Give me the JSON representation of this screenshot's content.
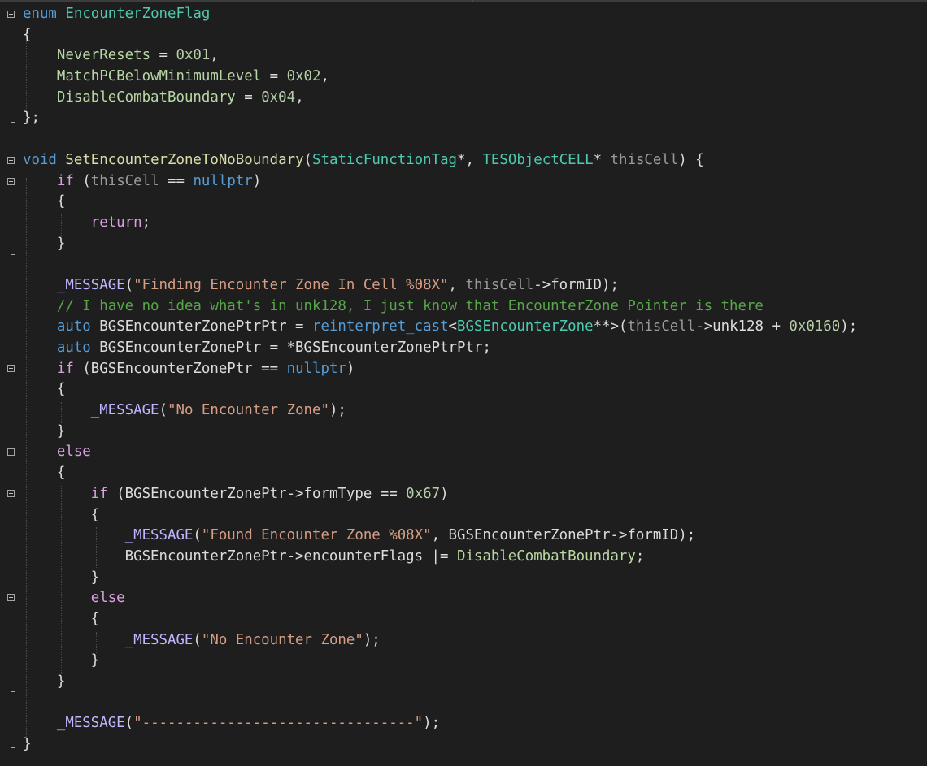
{
  "code_lines": [
    [
      [
        "kw",
        "enum"
      ],
      [
        "",
        "&nbsp;"
      ],
      [
        "ty",
        "EncounterZoneFlag"
      ]
    ],
    [
      [
        "",
        "{"
      ]
    ],
    [
      [
        "",
        "    "
      ],
      [
        "en",
        "NeverResets"
      ],
      [
        "",
        " = "
      ],
      [
        "num",
        "0x01"
      ],
      [
        "",
        ","
      ]
    ],
    [
      [
        "",
        "    "
      ],
      [
        "en",
        "MatchPCBelowMinimumLevel"
      ],
      [
        "",
        " = "
      ],
      [
        "num",
        "0x02"
      ],
      [
        "",
        ","
      ]
    ],
    [
      [
        "",
        "    "
      ],
      [
        "en",
        "DisableCombatBoundary"
      ],
      [
        "",
        " = "
      ],
      [
        "num",
        "0x04"
      ],
      [
        "",
        ","
      ]
    ],
    [
      [
        "",
        "};"
      ]
    ],
    [
      [
        "",
        ""
      ]
    ],
    [
      [
        "kw",
        "void"
      ],
      [
        "",
        " "
      ],
      [
        "fn",
        "SetEncounterZoneToNoBoundary"
      ],
      [
        "",
        "("
      ],
      [
        "ty",
        "StaticFunctionTag"
      ],
      [
        "",
        "*, "
      ],
      [
        "ty",
        "TESObjectCELL"
      ],
      [
        "",
        "* "
      ],
      [
        "pm",
        "thisCell"
      ],
      [
        "",
        ") {"
      ]
    ],
    [
      [
        "",
        "    "
      ],
      [
        "ctl",
        "if"
      ],
      [
        "",
        " ("
      ],
      [
        "pm",
        "thisCell"
      ],
      [
        "",
        " == "
      ],
      [
        "kw",
        "nullptr"
      ],
      [
        "",
        ")"
      ]
    ],
    [
      [
        "",
        "    {"
      ]
    ],
    [
      [
        "",
        "        "
      ],
      [
        "ctl",
        "return"
      ],
      [
        "",
        ";"
      ]
    ],
    [
      [
        "",
        "    }"
      ]
    ],
    [
      [
        "",
        ""
      ]
    ],
    [
      [
        "",
        "    "
      ],
      [
        "mac",
        "_MESSAGE"
      ],
      [
        "",
        "("
      ],
      [
        "str",
        "\"Finding Encounter Zone In Cell %08X\""
      ],
      [
        "",
        ", "
      ],
      [
        "pm",
        "thisCell"
      ],
      [
        "",
        "->formID);"
      ]
    ],
    [
      [
        "",
        "    "
      ],
      [
        "cm",
        "// I have no idea what's in unk128, I just know that EncounterZone Pointer is there"
      ]
    ],
    [
      [
        "",
        "    "
      ],
      [
        "kw",
        "auto"
      ],
      [
        "",
        " BGSEncounterZonePtrPtr = "
      ],
      [
        "kw",
        "reinterpret_cast"
      ],
      [
        "",
        "<"
      ],
      [
        "ty",
        "BGSEncounterZone"
      ],
      [
        "",
        "**>("
      ],
      [
        "pm",
        "thisCell"
      ],
      [
        "",
        "->unk128 + "
      ],
      [
        "num",
        "0x0160"
      ],
      [
        "",
        ");"
      ]
    ],
    [
      [
        "",
        "    "
      ],
      [
        "kw",
        "auto"
      ],
      [
        "",
        " BGSEncounterZonePtr = *BGSEncounterZonePtrPtr;"
      ]
    ],
    [
      [
        "",
        "    "
      ],
      [
        "ctl",
        "if"
      ],
      [
        "",
        " (BGSEncounterZonePtr == "
      ],
      [
        "kw",
        "nullptr"
      ],
      [
        "",
        ")"
      ]
    ],
    [
      [
        "",
        "    {"
      ]
    ],
    [
      [
        "",
        "        "
      ],
      [
        "mac",
        "_MESSAGE"
      ],
      [
        "",
        "("
      ],
      [
        "str",
        "\"No Encounter Zone\""
      ],
      [
        "",
        ");"
      ]
    ],
    [
      [
        "",
        "    }"
      ]
    ],
    [
      [
        "",
        "    "
      ],
      [
        "ctl",
        "else"
      ]
    ],
    [
      [
        "",
        "    {"
      ]
    ],
    [
      [
        "",
        "        "
      ],
      [
        "ctl",
        "if"
      ],
      [
        "",
        " (BGSEncounterZonePtr->formType == "
      ],
      [
        "num",
        "0x67"
      ],
      [
        "",
        ")"
      ]
    ],
    [
      [
        "",
        "        {"
      ]
    ],
    [
      [
        "",
        "            "
      ],
      [
        "mac",
        "_MESSAGE"
      ],
      [
        "",
        "("
      ],
      [
        "str",
        "\"Found Encounter Zone %08X\""
      ],
      [
        "",
        ", BGSEncounterZonePtr->formID);"
      ]
    ],
    [
      [
        "",
        "            BGSEncounterZonePtr->encounterFlags |= "
      ],
      [
        "en",
        "DisableCombatBoundary"
      ],
      [
        "",
        ";"
      ]
    ],
    [
      [
        "",
        "        }"
      ]
    ],
    [
      [
        "",
        "        "
      ],
      [
        "ctl",
        "else"
      ]
    ],
    [
      [
        "",
        "        {"
      ]
    ],
    [
      [
        "",
        "            "
      ],
      [
        "mac",
        "_MESSAGE"
      ],
      [
        "",
        "("
      ],
      [
        "str",
        "\"No Encounter Zone\""
      ],
      [
        "",
        ");"
      ]
    ],
    [
      [
        "",
        "        }"
      ]
    ],
    [
      [
        "",
        "    }"
      ]
    ],
    [
      [
        "",
        ""
      ]
    ],
    [
      [
        "",
        "    "
      ],
      [
        "mac",
        "_MESSAGE"
      ],
      [
        "",
        "("
      ],
      [
        "str",
        "\"--------------------------------\""
      ],
      [
        "",
        ");"
      ]
    ],
    [
      [
        "",
        "}"
      ]
    ]
  ],
  "token_colors": {
    "keyword": "#569cd6",
    "control": "#d8a0df",
    "type": "#4ec9b0",
    "function": "#dcdcaa",
    "string": "#d69d85",
    "number": "#b5cea8",
    "comment": "#57a64a",
    "parameter": "#9a9a9a",
    "enum_member": "#b8d7a3",
    "macro": "#beb7ff",
    "default": "#dcdcdc",
    "background": "#1e1e1e"
  }
}
